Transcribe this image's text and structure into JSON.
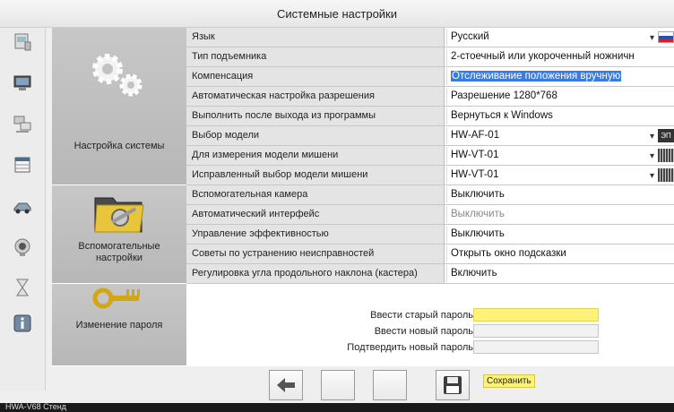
{
  "window": {
    "title": "Системные настройки"
  },
  "sidebar": {
    "items": [
      {
        "icon": "printer-icon"
      },
      {
        "icon": "computer-icon"
      },
      {
        "icon": "network-icon"
      },
      {
        "icon": "table-icon"
      },
      {
        "icon": "car-lift-icon"
      },
      {
        "icon": "camera-icon"
      },
      {
        "icon": "hourglass-icon"
      },
      {
        "icon": "info-icon"
      }
    ]
  },
  "sections": {
    "system": {
      "label": "Настройка системы",
      "rows": [
        {
          "label": "Язык",
          "value": "Русский"
        },
        {
          "label": "Тип подъемника",
          "value": "2-стоечный или укороченный ножничн"
        },
        {
          "label": "Компенсация",
          "value": "Отслеживание положения вручную"
        },
        {
          "label": "Автоматическая настройка разрешения",
          "value": "Разрешение 1280*768"
        },
        {
          "label": "Выполнить после выхода из программы",
          "value": "Вернуться к Windows"
        },
        {
          "label": "Выбор модели",
          "value": "HW-AF-01"
        },
        {
          "label": "Для измерения модели мишени",
          "value": "HW-VT-01"
        },
        {
          "label": "Исправленный выбор модели мишени",
          "value": "HW-VT-01"
        }
      ]
    },
    "aux": {
      "label_line1": "Вспомогательные",
      "label_line2": "настройки",
      "rows": [
        {
          "label": "Вспомогательная камера",
          "value": "Выключить"
        },
        {
          "label": "Автоматический интерфейс",
          "value": "Выключить"
        },
        {
          "label": "Управление эффективностью",
          "value": "Выключить"
        },
        {
          "label": "Советы по устранению неисправностей",
          "value": "Открыть окно подсказки"
        },
        {
          "label": "Регулировка угла продольного наклона (кастера)",
          "value": "Включить"
        }
      ]
    },
    "password": {
      "label": "Изменение пароля",
      "rows": [
        {
          "label": "Ввести старый пароль"
        },
        {
          "label": "Ввести новый пароль"
        },
        {
          "label": "Подтвердить новый пароль"
        }
      ]
    }
  },
  "toolbar": {
    "back_icon": "back-arrow-icon",
    "save_icon": "floppy-disk-icon",
    "save_label": "Сохранить"
  },
  "model_badge": "ЭП",
  "status": {
    "text": "HWA-V68  Стенд"
  },
  "colors": {
    "highlight": "#3a7be0",
    "password_active": "#fdf27a",
    "section_bg": "#bdbdbd",
    "label_bg": "#e4e4e4"
  }
}
